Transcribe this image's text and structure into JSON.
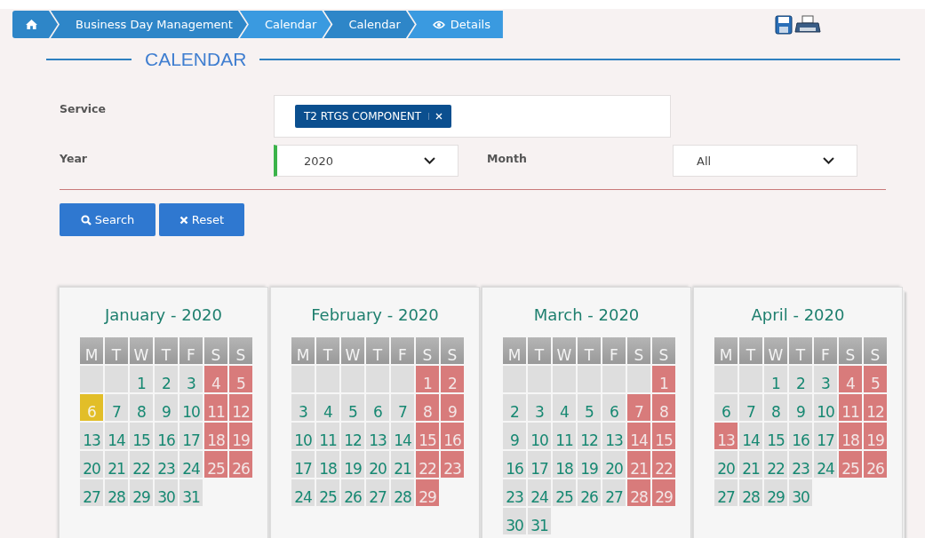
{
  "breadcrumb": [
    {
      "kind": "home"
    },
    {
      "kind": "text",
      "label": "Business Day Management"
    },
    {
      "kind": "text",
      "label": "Calendar"
    },
    {
      "kind": "text",
      "label": "Calendar"
    },
    {
      "kind": "eye",
      "label": "Details"
    }
  ],
  "heading": "CALENDAR",
  "service": {
    "label": "Service",
    "tags": [
      "T2 RTGS COMPONENT"
    ]
  },
  "year": {
    "label": "Year",
    "value": "2020"
  },
  "month": {
    "label": "Month",
    "value": "All"
  },
  "buttons": [
    {
      "kind": "search",
      "label": "Search"
    },
    {
      "kind": "reset",
      "label": "Reset"
    }
  ],
  "months": [
    {
      "title": "January - 2020",
      "weekdays": [
        "M",
        "T",
        "W",
        "T",
        "F",
        "S",
        "S"
      ],
      "weeks": [
        [
          {
            "kind": "blank"
          },
          {
            "kind": "blank"
          },
          {
            "day": "1",
            "kind": "open"
          },
          {
            "day": "2",
            "kind": "open"
          },
          {
            "day": "3",
            "kind": "open"
          },
          {
            "day": "4",
            "kind": "closed"
          },
          {
            "day": "5",
            "kind": "closed"
          }
        ],
        [
          {
            "day": "6",
            "kind": "today"
          },
          {
            "day": "7",
            "kind": "open"
          },
          {
            "day": "8",
            "kind": "open"
          },
          {
            "day": "9",
            "kind": "open"
          },
          {
            "day": "10",
            "kind": "open"
          },
          {
            "day": "11",
            "kind": "closed"
          },
          {
            "day": "12",
            "kind": "closed"
          }
        ],
        [
          {
            "day": "13",
            "kind": "open"
          },
          {
            "day": "14",
            "kind": "open"
          },
          {
            "day": "15",
            "kind": "open"
          },
          {
            "day": "16",
            "kind": "open"
          },
          {
            "day": "17",
            "kind": "open"
          },
          {
            "day": "18",
            "kind": "closed"
          },
          {
            "day": "19",
            "kind": "closed"
          }
        ],
        [
          {
            "day": "20",
            "kind": "open"
          },
          {
            "day": "21",
            "kind": "open"
          },
          {
            "day": "22",
            "kind": "open"
          },
          {
            "day": "23",
            "kind": "open"
          },
          {
            "day": "24",
            "kind": "open"
          },
          {
            "day": "25",
            "kind": "closed"
          },
          {
            "day": "26",
            "kind": "closed"
          }
        ],
        [
          {
            "day": "27",
            "kind": "open"
          },
          {
            "day": "28",
            "kind": "open"
          },
          {
            "day": "29",
            "kind": "open"
          },
          {
            "day": "30",
            "kind": "open"
          },
          {
            "day": "31",
            "kind": "open"
          }
        ]
      ]
    },
    {
      "title": "February - 2020",
      "weekdays": [
        "M",
        "T",
        "W",
        "T",
        "F",
        "S",
        "S"
      ],
      "weeks": [
        [
          {
            "kind": "blank"
          },
          {
            "kind": "blank"
          },
          {
            "kind": "blank"
          },
          {
            "kind": "blank"
          },
          {
            "kind": "blank"
          },
          {
            "day": "1",
            "kind": "closed"
          },
          {
            "day": "2",
            "kind": "closed"
          }
        ],
        [
          {
            "day": "3",
            "kind": "open"
          },
          {
            "day": "4",
            "kind": "open"
          },
          {
            "day": "5",
            "kind": "open"
          },
          {
            "day": "6",
            "kind": "open"
          },
          {
            "day": "7",
            "kind": "open"
          },
          {
            "day": "8",
            "kind": "closed"
          },
          {
            "day": "9",
            "kind": "closed"
          }
        ],
        [
          {
            "day": "10",
            "kind": "open"
          },
          {
            "day": "11",
            "kind": "open"
          },
          {
            "day": "12",
            "kind": "open"
          },
          {
            "day": "13",
            "kind": "open"
          },
          {
            "day": "14",
            "kind": "open"
          },
          {
            "day": "15",
            "kind": "closed"
          },
          {
            "day": "16",
            "kind": "closed"
          }
        ],
        [
          {
            "day": "17",
            "kind": "open"
          },
          {
            "day": "18",
            "kind": "open"
          },
          {
            "day": "19",
            "kind": "open"
          },
          {
            "day": "20",
            "kind": "open"
          },
          {
            "day": "21",
            "kind": "open"
          },
          {
            "day": "22",
            "kind": "closed"
          },
          {
            "day": "23",
            "kind": "closed"
          }
        ],
        [
          {
            "day": "24",
            "kind": "open"
          },
          {
            "day": "25",
            "kind": "open"
          },
          {
            "day": "26",
            "kind": "open"
          },
          {
            "day": "27",
            "kind": "open"
          },
          {
            "day": "28",
            "kind": "open"
          },
          {
            "day": "29",
            "kind": "closed"
          }
        ]
      ]
    },
    {
      "title": "March - 2020",
      "weekdays": [
        "M",
        "T",
        "W",
        "T",
        "F",
        "S",
        "S"
      ],
      "weeks": [
        [
          {
            "kind": "blank"
          },
          {
            "kind": "blank"
          },
          {
            "kind": "blank"
          },
          {
            "kind": "blank"
          },
          {
            "kind": "blank"
          },
          {
            "kind": "blank"
          },
          {
            "day": "1",
            "kind": "closed"
          }
        ],
        [
          {
            "day": "2",
            "kind": "open"
          },
          {
            "day": "3",
            "kind": "open"
          },
          {
            "day": "4",
            "kind": "open"
          },
          {
            "day": "5",
            "kind": "open"
          },
          {
            "day": "6",
            "kind": "open"
          },
          {
            "day": "7",
            "kind": "closed"
          },
          {
            "day": "8",
            "kind": "closed"
          }
        ],
        [
          {
            "day": "9",
            "kind": "open"
          },
          {
            "day": "10",
            "kind": "open"
          },
          {
            "day": "11",
            "kind": "open"
          },
          {
            "day": "12",
            "kind": "open"
          },
          {
            "day": "13",
            "kind": "open"
          },
          {
            "day": "14",
            "kind": "closed"
          },
          {
            "day": "15",
            "kind": "closed"
          }
        ],
        [
          {
            "day": "16",
            "kind": "open"
          },
          {
            "day": "17",
            "kind": "open"
          },
          {
            "day": "18",
            "kind": "open"
          },
          {
            "day": "19",
            "kind": "open"
          },
          {
            "day": "20",
            "kind": "open"
          },
          {
            "day": "21",
            "kind": "closed"
          },
          {
            "day": "22",
            "kind": "closed"
          }
        ],
        [
          {
            "day": "23",
            "kind": "open"
          },
          {
            "day": "24",
            "kind": "open"
          },
          {
            "day": "25",
            "kind": "open"
          },
          {
            "day": "26",
            "kind": "open"
          },
          {
            "day": "27",
            "kind": "open"
          },
          {
            "day": "28",
            "kind": "closed"
          },
          {
            "day": "29",
            "kind": "closed"
          }
        ],
        [
          {
            "day": "30",
            "kind": "open"
          },
          {
            "day": "31",
            "kind": "open"
          }
        ]
      ]
    },
    {
      "title": "April - 2020",
      "weekdays": [
        "M",
        "T",
        "W",
        "T",
        "F",
        "S",
        "S"
      ],
      "weeks": [
        [
          {
            "kind": "blank"
          },
          {
            "kind": "blank"
          },
          {
            "day": "1",
            "kind": "open"
          },
          {
            "day": "2",
            "kind": "open"
          },
          {
            "day": "3",
            "kind": "open"
          },
          {
            "day": "4",
            "kind": "closed"
          },
          {
            "day": "5",
            "kind": "closed"
          }
        ],
        [
          {
            "day": "6",
            "kind": "open"
          },
          {
            "day": "7",
            "kind": "open"
          },
          {
            "day": "8",
            "kind": "open"
          },
          {
            "day": "9",
            "kind": "open"
          },
          {
            "day": "10",
            "kind": "open"
          },
          {
            "day": "11",
            "kind": "closed"
          },
          {
            "day": "12",
            "kind": "closed"
          }
        ],
        [
          {
            "day": "13",
            "kind": "closed"
          },
          {
            "day": "14",
            "kind": "open"
          },
          {
            "day": "15",
            "kind": "open"
          },
          {
            "day": "16",
            "kind": "open"
          },
          {
            "day": "17",
            "kind": "open"
          },
          {
            "day": "18",
            "kind": "closed"
          },
          {
            "day": "19",
            "kind": "closed"
          }
        ],
        [
          {
            "day": "20",
            "kind": "open"
          },
          {
            "day": "21",
            "kind": "open"
          },
          {
            "day": "22",
            "kind": "open"
          },
          {
            "day": "23",
            "kind": "open"
          },
          {
            "day": "24",
            "kind": "open"
          },
          {
            "day": "25",
            "kind": "closed"
          },
          {
            "day": "26",
            "kind": "closed"
          }
        ],
        [
          {
            "day": "27",
            "kind": "open"
          },
          {
            "day": "28",
            "kind": "open"
          },
          {
            "day": "29",
            "kind": "open"
          },
          {
            "day": "30",
            "kind": "open"
          }
        ]
      ]
    }
  ]
}
